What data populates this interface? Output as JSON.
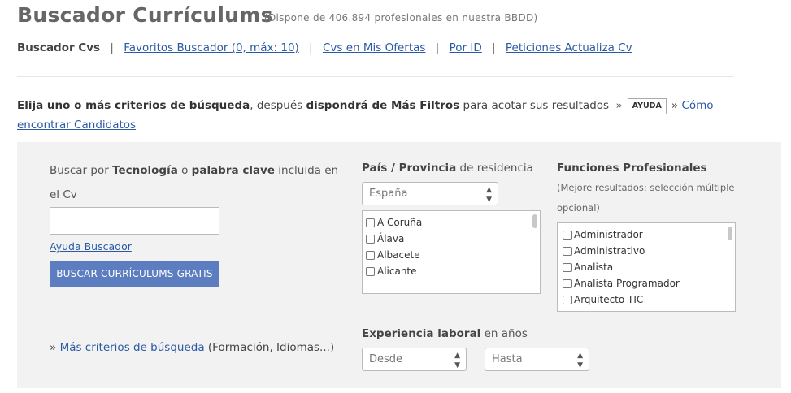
{
  "header": {
    "title": "Buscador Currículums",
    "subtitle": "(Dispone de 406.894 profesionales en nuestra BBDD)"
  },
  "nav": {
    "current": "Buscador Cvs",
    "links": [
      "Favoritos Buscador (0, máx: 10)",
      "Cvs en Mis Ofertas",
      "Por ID",
      "Peticiones Actualiza Cv"
    ],
    "separator": "|"
  },
  "intro": {
    "part1_bold": "Elija uno o más criterios de búsqueda",
    "part2": ", después ",
    "part3_bold": "dispondrá de Más Filtros",
    "part4": " para acotar sus resultados",
    "guillemet": "»",
    "ayuda_button": "AYUDA",
    "link": "Cómo encontrar Candidatos"
  },
  "keyword_search": {
    "label_1": "Buscar por ",
    "label_bold_1": "Tecnología",
    "label_2": " o ",
    "label_bold_2": "palabra clave",
    "label_3": " incluida en",
    "label_line2": "el Cv",
    "input_value": "",
    "help_link": "Ayuda Buscador",
    "button": "BUSCAR CURRÍCULUMS GRATIS",
    "more_prefix": "»",
    "more_link": "Más criterios de búsqueda",
    "more_suffix": " (Formación, Idiomas...)"
  },
  "location": {
    "title_bold": "País / Provincia",
    "title_rest": " de residencia",
    "country_selected": "España",
    "provinces": [
      "A Coruña",
      "Álava",
      "Albacete",
      "Alicante"
    ]
  },
  "functions": {
    "title": "Funciones Profesionales",
    "note_line1": "(Mejore resultados: selección múltiple",
    "note_line2": "opcional)",
    "items": [
      "Administrador",
      "Administrativo",
      "Analista",
      "Analista Programador",
      "Arquitecto TIC"
    ]
  },
  "experience": {
    "title_bold": "Experiencia laboral",
    "title_rest": " en años",
    "from_selected": "Desde",
    "to_selected": "Hasta"
  },
  "icons": {
    "select_arrows": "▴▾"
  }
}
